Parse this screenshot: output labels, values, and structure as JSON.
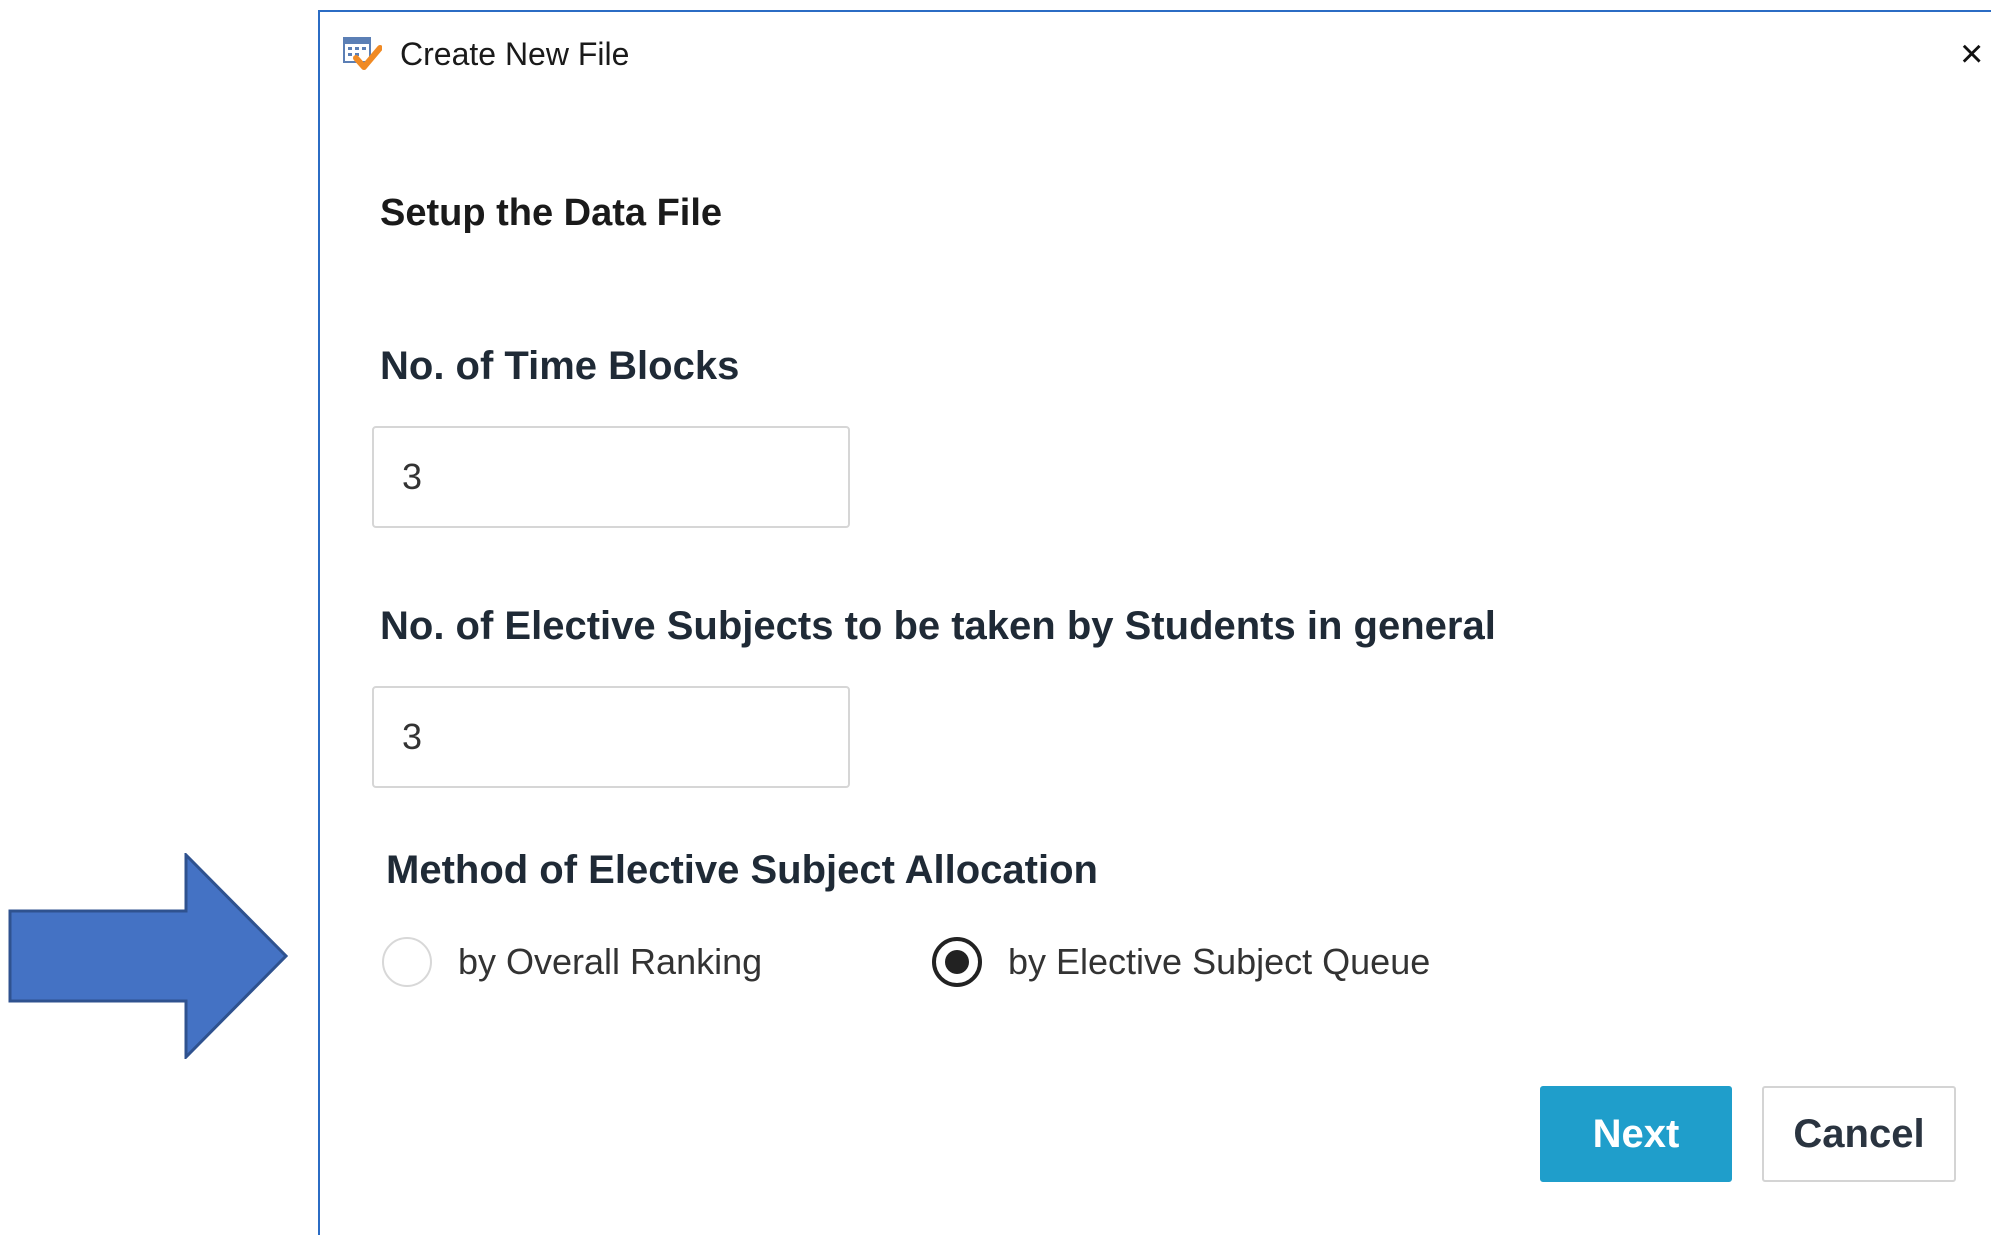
{
  "annotation": {
    "arrow_color": "#4472c4",
    "arrow_icon": "arrow-right-icon"
  },
  "dialog": {
    "title": "Create New File",
    "app_icon": "calendar-check-icon",
    "close_icon": "close-icon",
    "close_glyph": "×",
    "heading": "Setup the Data File",
    "time_blocks": {
      "label": "No. of Time Blocks",
      "value": "3"
    },
    "electives": {
      "label": "No. of Elective Subjects to be taken by Students in general",
      "value": "3"
    },
    "allocation": {
      "label": "Method of Elective Subject Allocation",
      "options": [
        {
          "label": "by Overall Ranking",
          "selected": false
        },
        {
          "label": "by Elective Subject Queue",
          "selected": true
        }
      ]
    },
    "buttons": {
      "next": "Next",
      "cancel": "Cancel"
    },
    "colors": {
      "border": "#2b6cc4",
      "primary_button": "#1f9ecb"
    }
  }
}
